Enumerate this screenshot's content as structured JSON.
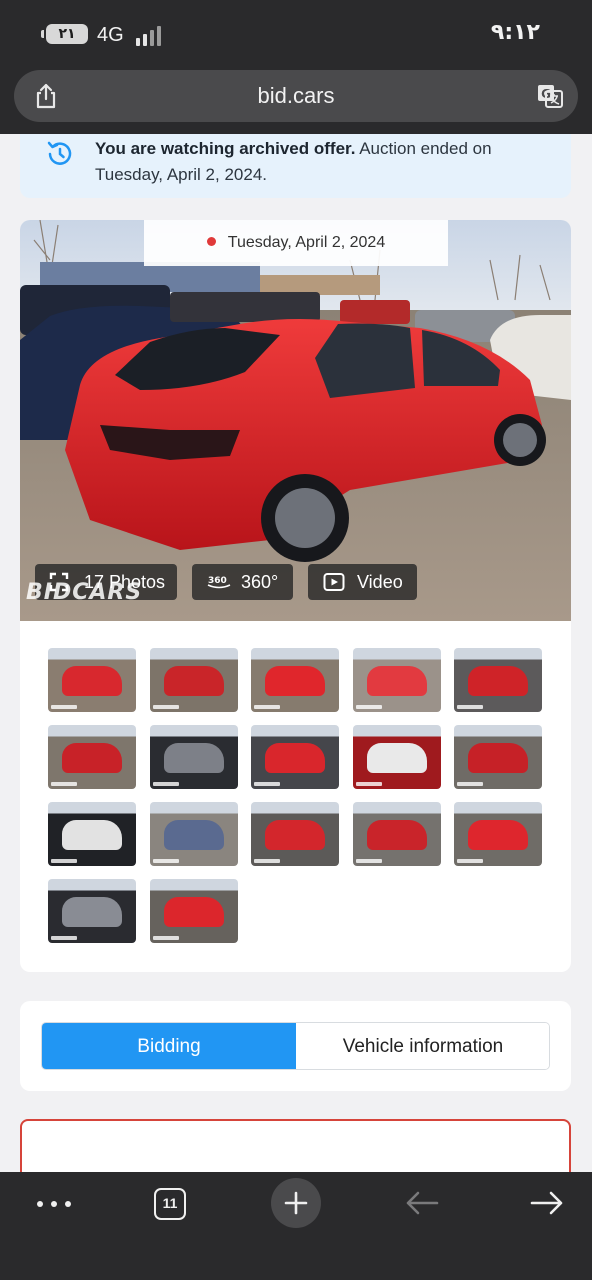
{
  "status_bar": {
    "battery": "٢١",
    "network": "4G",
    "time": "٩:١٢"
  },
  "browser": {
    "url": "bid.cars",
    "share_icon": "share-icon",
    "translate_icon": "translate-icon",
    "tab_count": "11"
  },
  "notice": {
    "bold_text": "You are watching archived offer.",
    "text": " Auction ended on Tuesday, April 2, 2024.",
    "icon": "history-icon"
  },
  "gallery": {
    "date": "Tuesday, April 2, 2024",
    "photos_label": "17 Photos",
    "view360_label": "360°",
    "video_label": "Video",
    "watermark": "BIDCARS",
    "thumbnails": [
      {
        "name": "thumb-rear-left"
      },
      {
        "name": "thumb-front-damage"
      },
      {
        "name": "thumb-rear-right"
      },
      {
        "name": "thumb-rear"
      },
      {
        "name": "thumb-interior-front"
      },
      {
        "name": "thumb-front-closeup"
      },
      {
        "name": "thumb-gauges"
      },
      {
        "name": "thumb-rear-seats"
      },
      {
        "name": "thumb-door-label"
      },
      {
        "name": "thumb-engine"
      },
      {
        "name": "thumb-console"
      },
      {
        "name": "thumb-parts"
      },
      {
        "name": "thumb-front-lot"
      },
      {
        "name": "thumb-side-lot"
      },
      {
        "name": "thumb-rear-lot"
      },
      {
        "name": "thumb-instrument"
      },
      {
        "name": "thumb-rear-final"
      }
    ]
  },
  "tabs": {
    "bidding": "Bidding",
    "vehicle_info": "Vehicle information"
  },
  "bottom_bar": {
    "more_icon": "more-icon",
    "new_tab_icon": "plus-icon",
    "back_icon": "back-arrow-icon",
    "forward_icon": "forward-arrow-icon"
  },
  "colors": {
    "accent": "#2196f3",
    "notice_bg": "#e6f2fc",
    "alert_red": "#d6443a"
  }
}
